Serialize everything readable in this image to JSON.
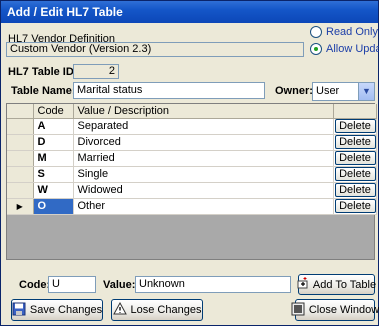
{
  "window": {
    "title": "Add / Edit HL7 Table"
  },
  "vendor": {
    "label": "HL7 Vendor Definition",
    "value": "Custom Vendor (Version 2.3)"
  },
  "radios": [
    {
      "label": "Read Only",
      "selected": false
    },
    {
      "label": "Allow Updates",
      "selected": true
    }
  ],
  "table_id": {
    "label": "HL7 Table ID:",
    "value": "2"
  },
  "table_name": {
    "label": "Table Name:",
    "value": "Marital status"
  },
  "owner": {
    "label": "Owner:",
    "value": "User"
  },
  "grid": {
    "headers": [
      "Code",
      "Value / Description"
    ],
    "rows": [
      {
        "code": "A",
        "value": "Separated",
        "action": "Delete"
      },
      {
        "code": "D",
        "value": "Divorced",
        "action": "Delete"
      },
      {
        "code": "M",
        "value": "Married",
        "action": "Delete"
      },
      {
        "code": "S",
        "value": "Single",
        "action": "Delete"
      },
      {
        "code": "W",
        "value": "Widowed",
        "action": "Delete"
      },
      {
        "code": "O",
        "value": "Other",
        "action": "Delete",
        "current": true
      }
    ]
  },
  "entry": {
    "code_label": "Code:",
    "code_value": "U",
    "value_label": "Value:",
    "value_value": "Unknown",
    "add_label": "Add To Table"
  },
  "buttons": {
    "save": "Save Changes",
    "lose": "Lose Changes",
    "close": "Close Window"
  },
  "colors": {
    "title_bar": "#1456c8",
    "selection": "#316ac5",
    "window_bg": "#ece9d8"
  }
}
